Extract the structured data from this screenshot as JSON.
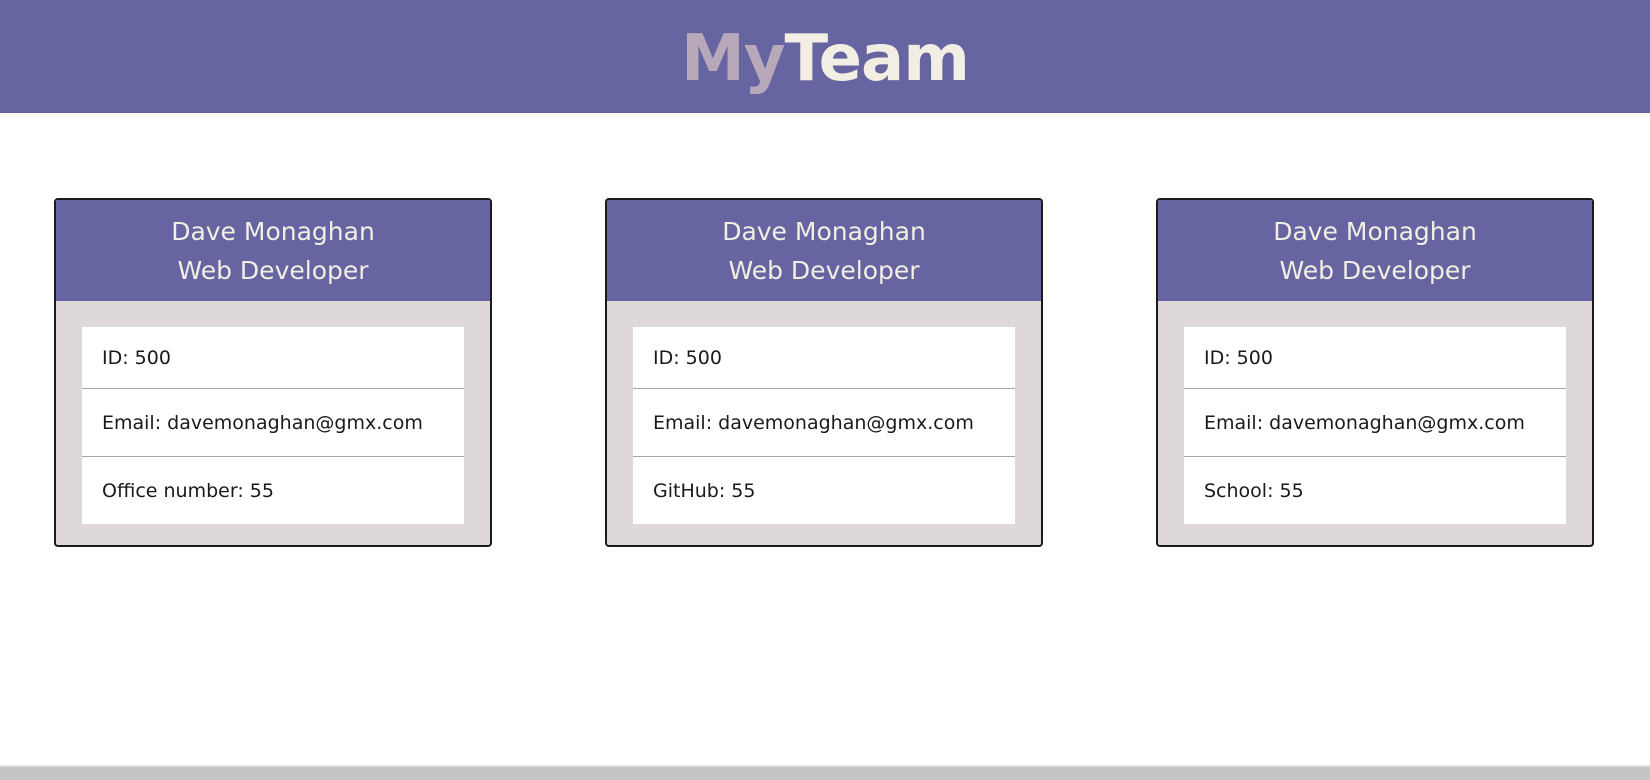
{
  "header": {
    "logo_part1": "My",
    "logo_part2": "Team"
  },
  "cards": [
    {
      "name": "Dave Monaghan",
      "role": "Web Developer",
      "id": "ID: 500",
      "email": "Email: davemonaghan@gmx.com",
      "extra": "Office number: 55"
    },
    {
      "name": "Dave Monaghan",
      "role": "Web Developer",
      "id": "ID: 500",
      "email": "Email: davemonaghan@gmx.com",
      "extra": "GitHub: 55"
    },
    {
      "name": "Dave Monaghan",
      "role": "Web Developer",
      "id": "ID: 500",
      "email": "Email: davemonaghan@gmx.com",
      "extra": "School: 55"
    }
  ],
  "colors": {
    "header_bg": "#6664a1",
    "logo_my": "#b7a9ba",
    "logo_team": "#f2eee3",
    "card_bg": "#ded8d8"
  }
}
